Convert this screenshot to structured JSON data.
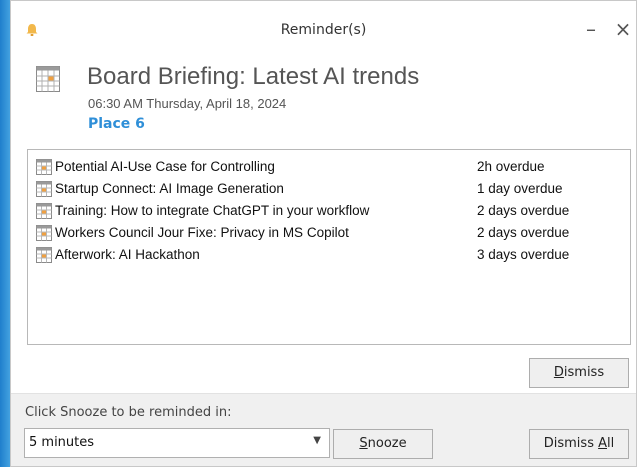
{
  "window": {
    "title": "Reminder(s)",
    "minimize_glyph": "–",
    "close_glyph": "×"
  },
  "selected": {
    "subject": "Board Briefing: Latest AI trends",
    "datetime": "06:30 AM Thursday, April 18, 2024",
    "location": "Place 6"
  },
  "reminders": [
    {
      "subject": "Potential AI-Use Case for Controlling",
      "due": "2h overdue"
    },
    {
      "subject": "Startup Connect: AI Image Generation",
      "due": "1 day overdue"
    },
    {
      "subject": "Training: How to integrate ChatGPT in your workflow",
      "due": "2 days overdue"
    },
    {
      "subject": "Workers Council Jour Fixe: Privacy in MS Copilot",
      "due": "2 days overdue"
    },
    {
      "subject": "Afterwork: AI Hackathon",
      "due": "3 days overdue"
    }
  ],
  "buttons": {
    "dismiss": {
      "pre": "",
      "key": "D",
      "post": "ismiss"
    },
    "snooze": {
      "pre": "",
      "key": "S",
      "post": "nooze"
    },
    "dismiss_all": {
      "pre": "Dismiss ",
      "key": "A",
      "post": "ll"
    }
  },
  "snooze": {
    "label": "Click Snooze to be reminded in:",
    "selected": "5 minutes"
  },
  "icons": {
    "bell": "bell-icon",
    "calendar": "calendar-icon",
    "dropdown": "chevron-down-icon"
  },
  "colors": {
    "accent": "#2f8fd8",
    "bell": "#f2b84b",
    "calendar_highlight": "#f0a040"
  }
}
